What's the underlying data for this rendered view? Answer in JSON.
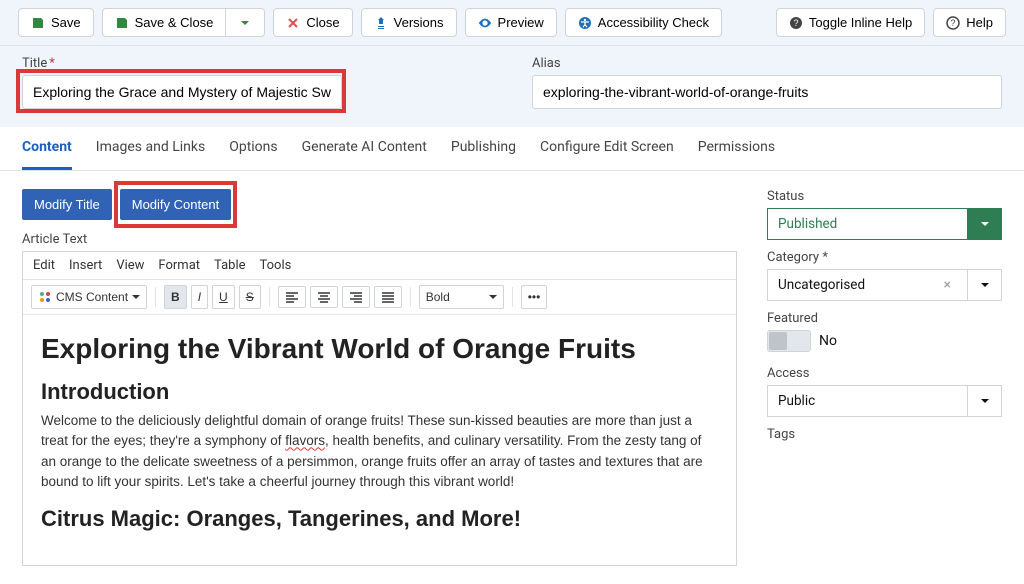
{
  "toolbar": {
    "save": "Save",
    "save_close": "Save & Close",
    "close": "Close",
    "versions": "Versions",
    "preview": "Preview",
    "accessibility": "Accessibility Check",
    "toggle_help": "Toggle Inline Help",
    "help": "Help"
  },
  "fields": {
    "title_label": "Title",
    "title_value": "Exploring the Grace and Mystery of Majestic Swans",
    "alias_label": "Alias",
    "alias_value": "exploring-the-vibrant-world-of-orange-fruits"
  },
  "tabs": {
    "content": "Content",
    "images": "Images and Links",
    "options": "Options",
    "ai": "Generate AI Content",
    "publishing": "Publishing",
    "configure": "Configure Edit Screen",
    "permissions": "Permissions"
  },
  "modify": {
    "title": "Modify Title",
    "content": "Modify Content"
  },
  "article_label": "Article Text",
  "editor": {
    "menu": {
      "edit": "Edit",
      "insert": "Insert",
      "view": "View",
      "format": "Format",
      "table": "Table",
      "tools": "Tools"
    },
    "cms": "CMS Content",
    "font_style": "Bold"
  },
  "body": {
    "h1": "Exploring the Vibrant World of Orange Fruits",
    "h2a": "Introduction",
    "p1_a": "Welcome to the deliciously delightful domain of orange fruits! These sun-kissed beauties are more than just a treat for the eyes; they're a symphony of ",
    "p1_flavors": "flavors",
    "p1_b": ", health benefits, and culinary versatility. From the zesty tang of an orange to the delicate sweetness of a persimmon, orange fruits offer an array of tastes and textures that are bound to lift your spirits. Let's take a cheerful journey through this vibrant world!",
    "h2b": "Citrus Magic: Oranges, Tangerines, and More!"
  },
  "side": {
    "status_label": "Status",
    "status_value": "Published",
    "category_label": "Category",
    "category_value": "Uncategorised",
    "featured_label": "Featured",
    "featured_value": "No",
    "access_label": "Access",
    "access_value": "Public",
    "tags_label": "Tags"
  },
  "required_marker": "*"
}
